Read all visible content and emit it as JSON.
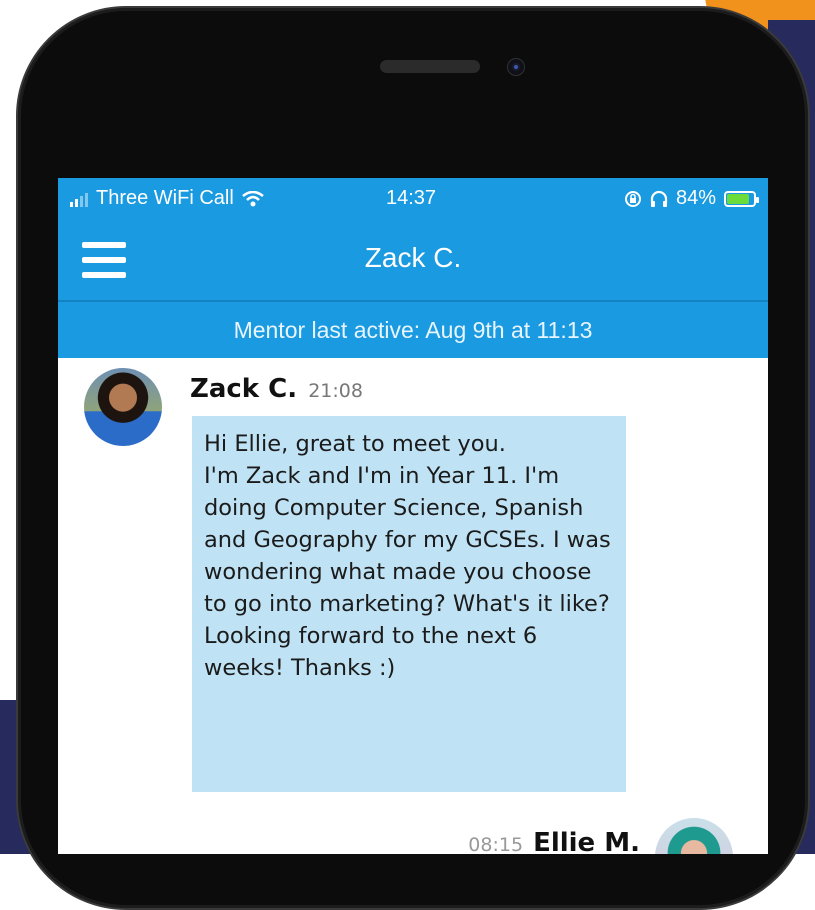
{
  "status_bar": {
    "carrier": "Three WiFi Call",
    "time": "14:37",
    "battery": "84%",
    "battery_level": 0.84
  },
  "nav": {
    "title": "Zack C.",
    "menu_icon": "hamburger-menu-icon"
  },
  "banner": {
    "text": "Mentor last active: Aug 9th at 11:13"
  },
  "messages": [
    {
      "sender": "Zack C.",
      "time": "21:08",
      "text": "Hi Ellie, great to meet you.\nI'm Zack and I'm in Year 11. I'm doing Computer Science, Spanish and Geography for my GCSEs. I was wondering what made you choose to go into marketing? What's it like? Looking forward to the next 6 weeks! Thanks :)"
    },
    {
      "sender": "Ellie M.",
      "time": "08:15"
    }
  ],
  "colors": {
    "primary": "#1a9ae0",
    "bubble": "#bfe3f5",
    "accent_orange": "#f0921c",
    "navy": "#262a5c"
  }
}
